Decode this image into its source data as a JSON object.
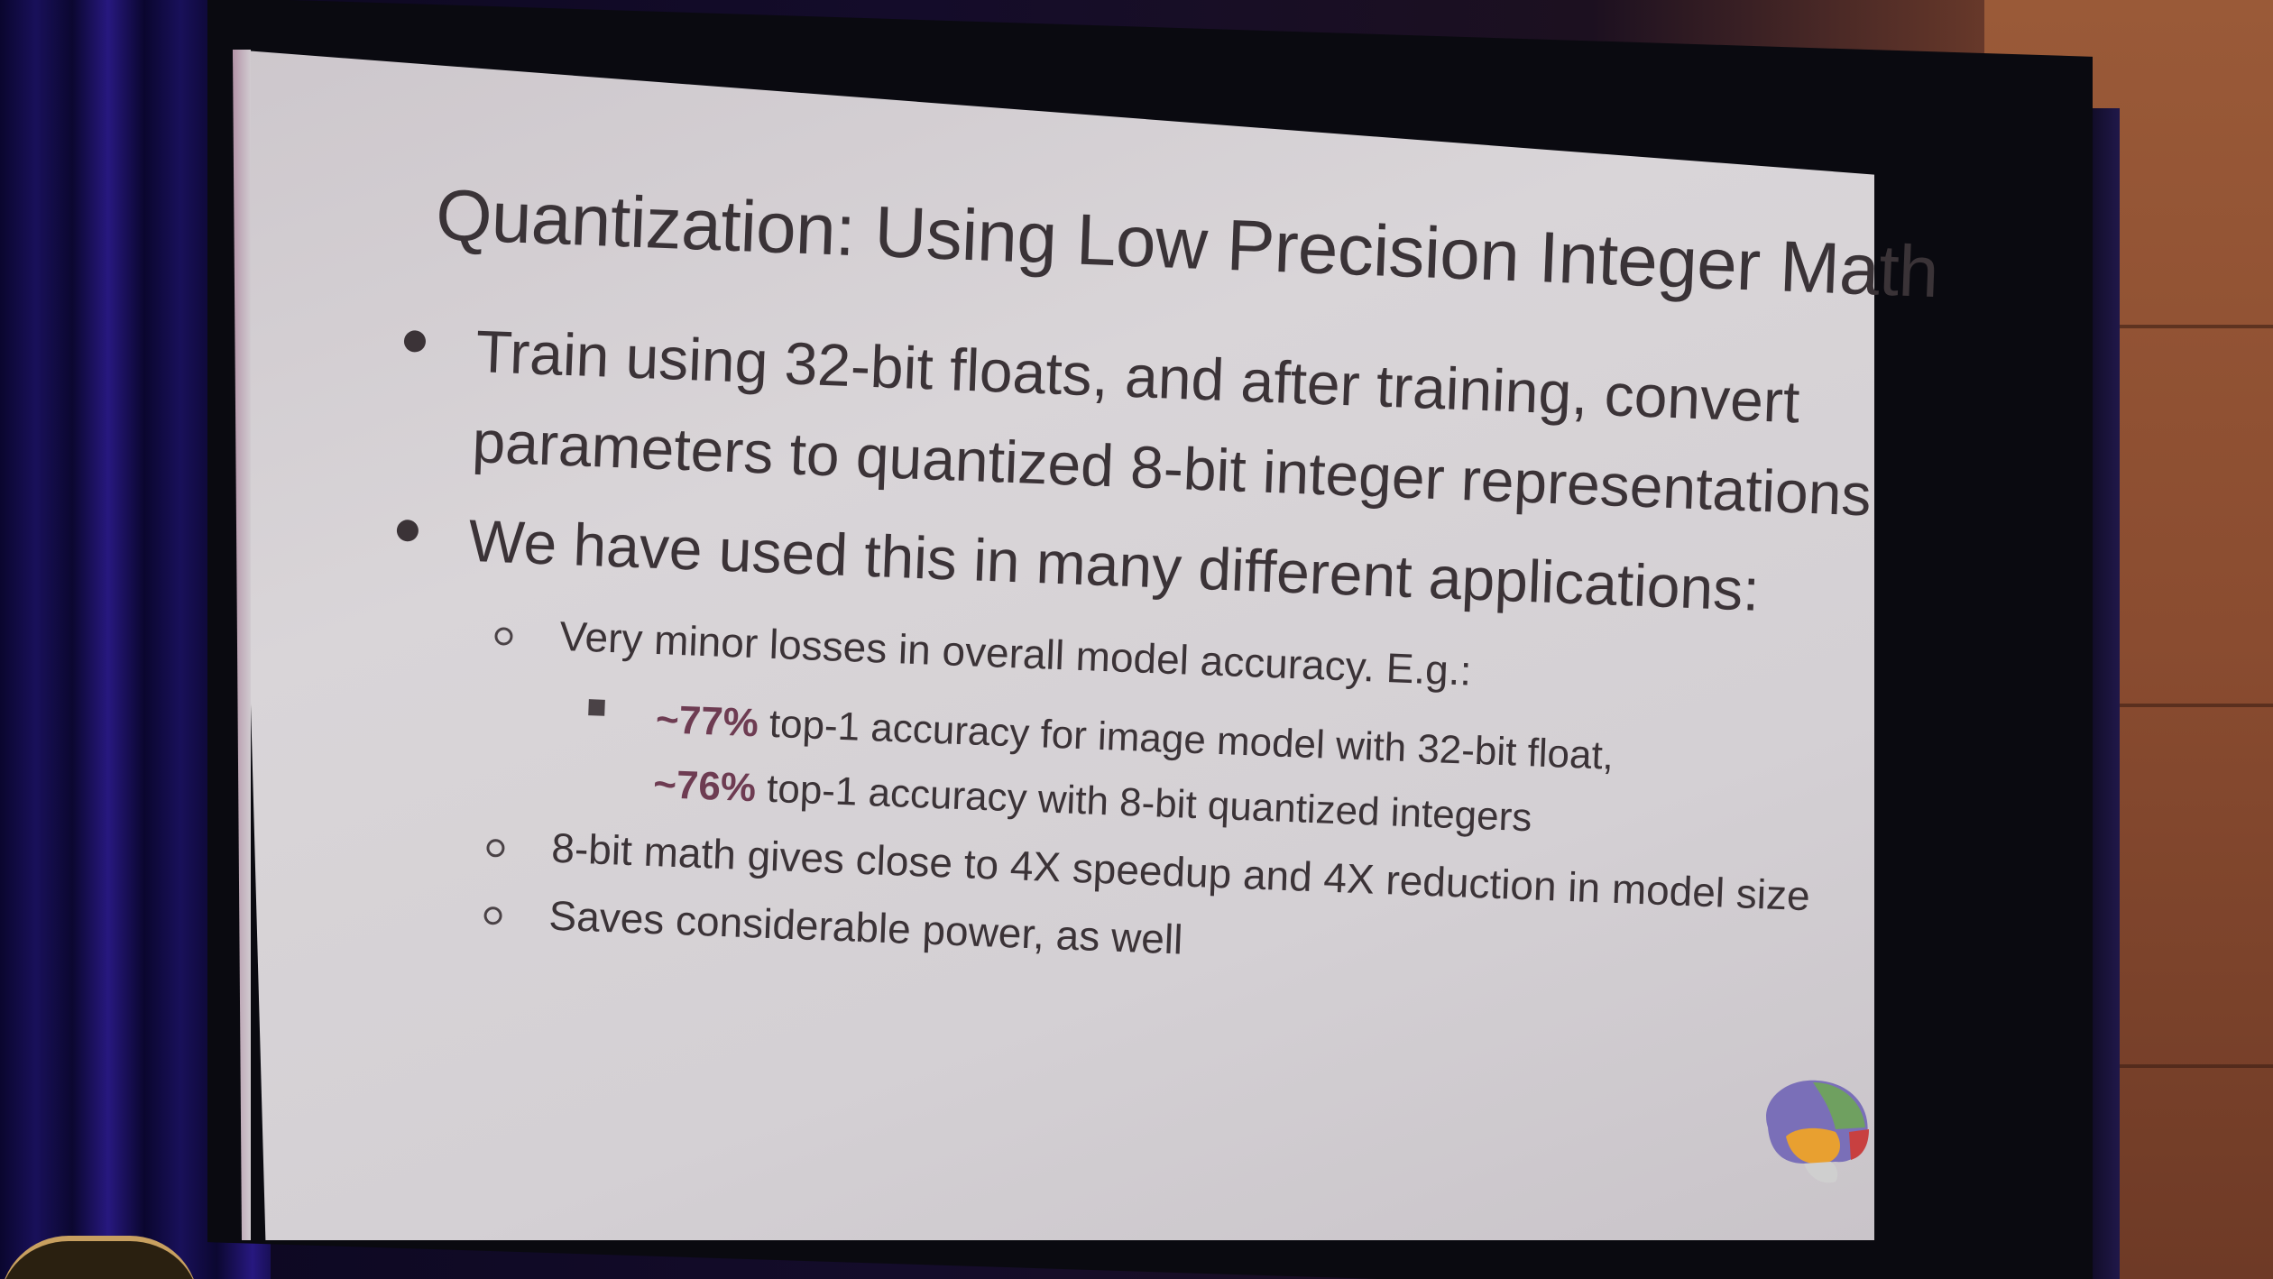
{
  "slide": {
    "title": "Quantization: Using Low Precision Integer Math",
    "bullets": [
      {
        "lines": [
          "Train using 32-bit floats, and after training, convert",
          "parameters to quantized 8-bit integer representations"
        ]
      },
      {
        "lines": [
          "We have used this in many different applications:"
        ]
      }
    ],
    "subbullets": [
      {
        "text": "Very minor losses in overall model accuracy.  E.g.:"
      },
      {
        "text": "8-bit math gives close to 4X speedup and 4X reduction in model size"
      },
      {
        "text": "Saves considerable power, as well"
      }
    ],
    "subsub": {
      "line1_highlight": "~77%",
      "line1_rest": " top-1 accuracy for image model with 32-bit float,",
      "line2_highlight": "~76%",
      "line2_rest": " top-1 accuracy with 8-bit quantized integers"
    },
    "colors": {
      "text": "#3b3337",
      "highlight": "#6e3c52",
      "slide_background": "#d6d2d6"
    },
    "logo_icon": "brain-logo-icon"
  }
}
